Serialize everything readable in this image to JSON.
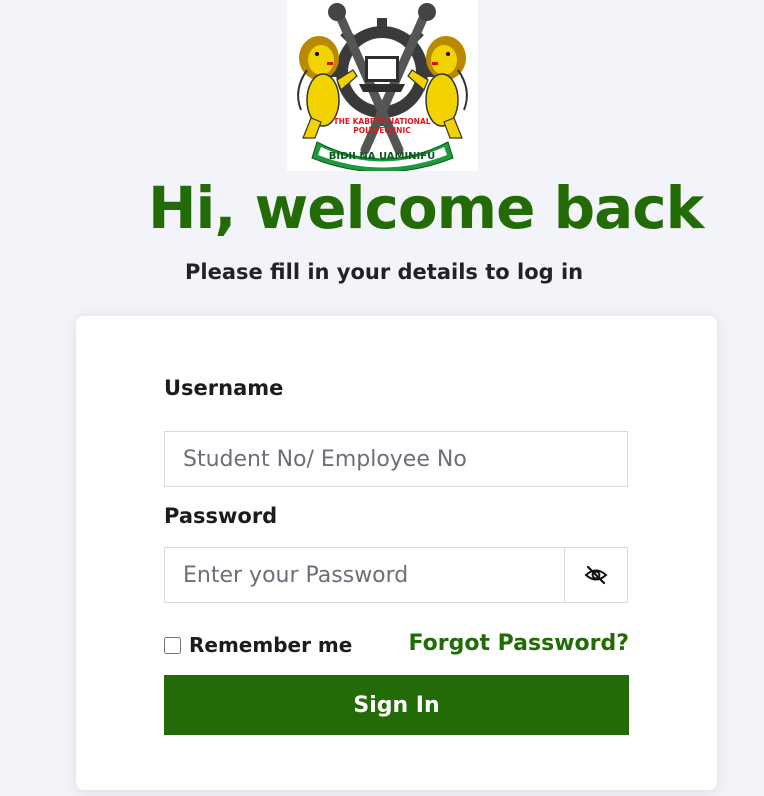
{
  "logo": {
    "motto": "BIDII NA UAMINIFU",
    "institution_line1": "THE KABETE NATIONAL",
    "institution_line2": "POLYTECHNIC"
  },
  "header": {
    "title": "Hi, welcome back",
    "subtitle": "Please fill in your details to log in"
  },
  "form": {
    "username_label": "Username",
    "username_placeholder": "Student No/ Employee No",
    "username_value": "",
    "password_label": "Password",
    "password_placeholder": "Enter your Password",
    "password_value": "",
    "password_toggle_icon": "eye-off-icon",
    "remember_label": "Remember me",
    "remember_checked": false,
    "forgot_label": "Forgot Password?",
    "submit_label": "Sign In"
  },
  "colors": {
    "brand_green": "#236b06",
    "background": "#f3f4f9",
    "card": "#ffffff"
  }
}
